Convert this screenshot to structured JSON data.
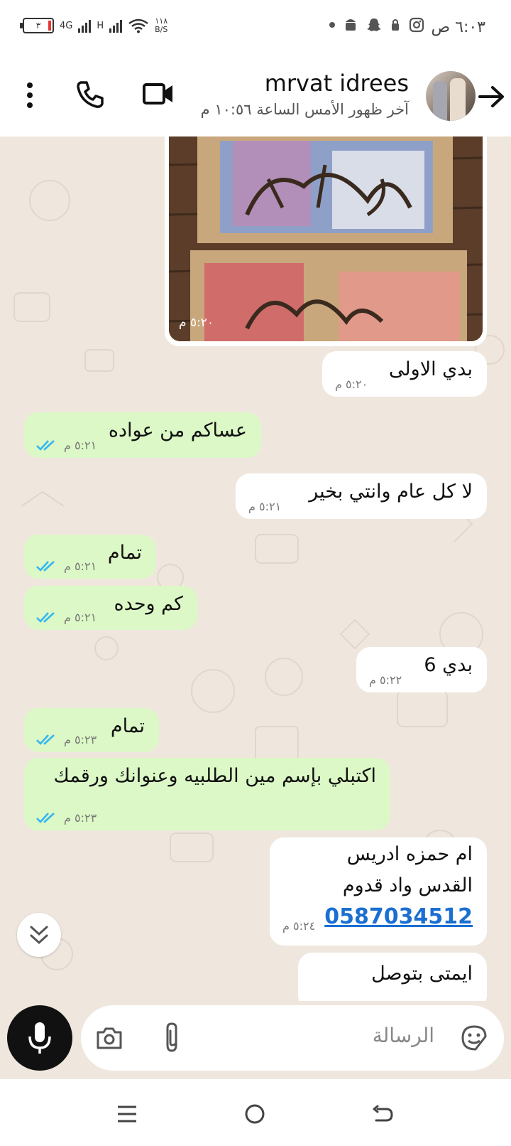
{
  "status_bar": {
    "time": "٦:٠٣ ص",
    "battery": "٣",
    "network_4g": "4G",
    "network_h": "H",
    "speed_value": "١١٨",
    "speed_unit": "B/S",
    "icons": [
      "dot-icon",
      "android-icon",
      "snapchat-icon",
      "lock-notification-icon",
      "instagram-icon"
    ]
  },
  "header": {
    "contact_name": "mrvat idrees",
    "last_seen": "آخر ظهور الأمس الساعة ١٠:٥٦ م",
    "icons": [
      "back-arrow-icon",
      "video-call-icon",
      "voice-call-icon",
      "more-options-icon"
    ]
  },
  "messages": [
    {
      "type": "image",
      "direction": "incoming",
      "time": "٥:٢٠ م"
    },
    {
      "type": "text",
      "direction": "incoming",
      "text": "بدي الاولى",
      "time": "٥:٢٠ م"
    },
    {
      "type": "text",
      "direction": "outgoing",
      "text": "عساكم من عواده",
      "time": "٥:٢١ م",
      "read": true
    },
    {
      "type": "text",
      "direction": "incoming",
      "text": "لا كل عام وانتي بخير",
      "time": "٥:٢١ م"
    },
    {
      "type": "text",
      "direction": "outgoing",
      "text": "تمام",
      "time": "٥:٢١ م",
      "read": true
    },
    {
      "type": "text",
      "direction": "outgoing",
      "text": "كم وحده",
      "time": "٥:٢١ م",
      "read": true
    },
    {
      "type": "text",
      "direction": "incoming",
      "text": "بدي 6",
      "time": "٥:٢٢ م"
    },
    {
      "type": "text",
      "direction": "outgoing",
      "text": "تمام",
      "time": "٥:٢٣ م",
      "read": true
    },
    {
      "type": "text",
      "direction": "outgoing",
      "text": "اكتبلي بإسم مين الطلبيه وعنوانك ورقمك",
      "time": "٥:٢٣ م",
      "read": true
    },
    {
      "type": "multi",
      "direction": "incoming",
      "lines": [
        "ام حمزه ادريس",
        "القدس واد قدوم"
      ],
      "phone": "0587034512",
      "time": "٥:٢٤ م"
    },
    {
      "type": "text",
      "direction": "incoming",
      "text": "ايمتى بتوصل",
      "time": ""
    }
  ],
  "input": {
    "placeholder": "الرسالة",
    "icons": [
      "sticker-icon",
      "attach-icon",
      "camera-icon",
      "mic-icon"
    ]
  },
  "colors": {
    "outgoing_bubble": "#dcf8c6",
    "incoming_bubble": "#ffffff",
    "chat_bg": "#efe7de",
    "read_ticks": "#34b7f1",
    "phone_link": "#1a6fd1"
  }
}
